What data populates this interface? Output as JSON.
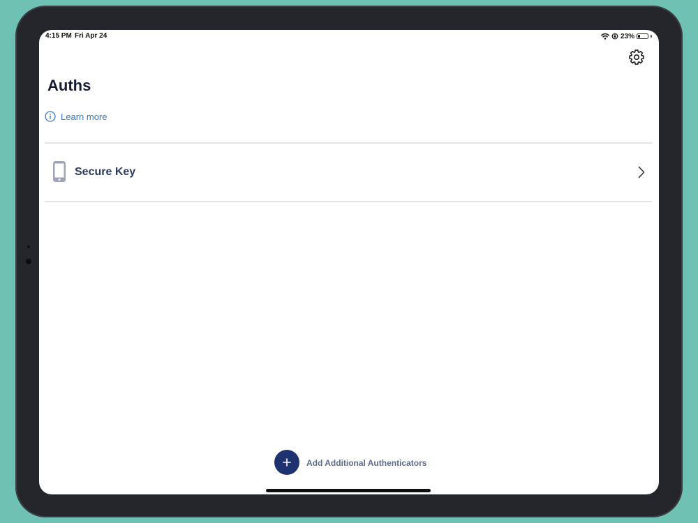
{
  "status_bar": {
    "time": "4:15 PM",
    "date": "Fri Apr 24",
    "battery_percent": "23%",
    "battery_level": 0.23
  },
  "header": {
    "title": "Auths",
    "settings_icon": "gear-icon"
  },
  "learn_more": {
    "label": "Learn more",
    "icon": "info-circle-icon"
  },
  "authenticators": [
    {
      "label": "Secure Key",
      "icon": "mobile-phone-icon"
    }
  ],
  "footer": {
    "add_label": "Add Additional Authenticators",
    "add_icon": "plus-icon"
  },
  "colors": {
    "background": "#6fc1b3",
    "device_frame": "#24262b",
    "title": "#141b33",
    "link": "#3a76c4",
    "item_text": "#2c3a5e",
    "add_button": "#1f3270",
    "add_label": "#5d6b8c"
  }
}
